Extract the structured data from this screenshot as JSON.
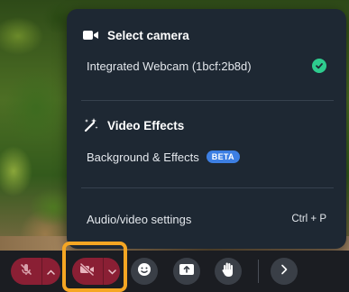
{
  "menu": {
    "camera_header": "Select camera",
    "camera_option": "Integrated Webcam (1bcf:2b8d)",
    "effects_header": "Video Effects",
    "effects_option": "Background & Effects",
    "effects_badge": "BETA",
    "settings_label": "Audio/video settings",
    "settings_shortcut": "Ctrl + P"
  },
  "toolbar": {
    "icons": [
      "mic-off-icon",
      "camera-off-icon",
      "emoji-icon",
      "share-screen-icon",
      "raise-hand-icon",
      "chevron-right-icon"
    ]
  },
  "colors": {
    "menu_bg": "#1e2833",
    "check_green": "#2ecc8e",
    "beta_blue": "#3d7fe3",
    "muted_red": "#8a1f34",
    "highlight_orange": "#f5a623"
  }
}
